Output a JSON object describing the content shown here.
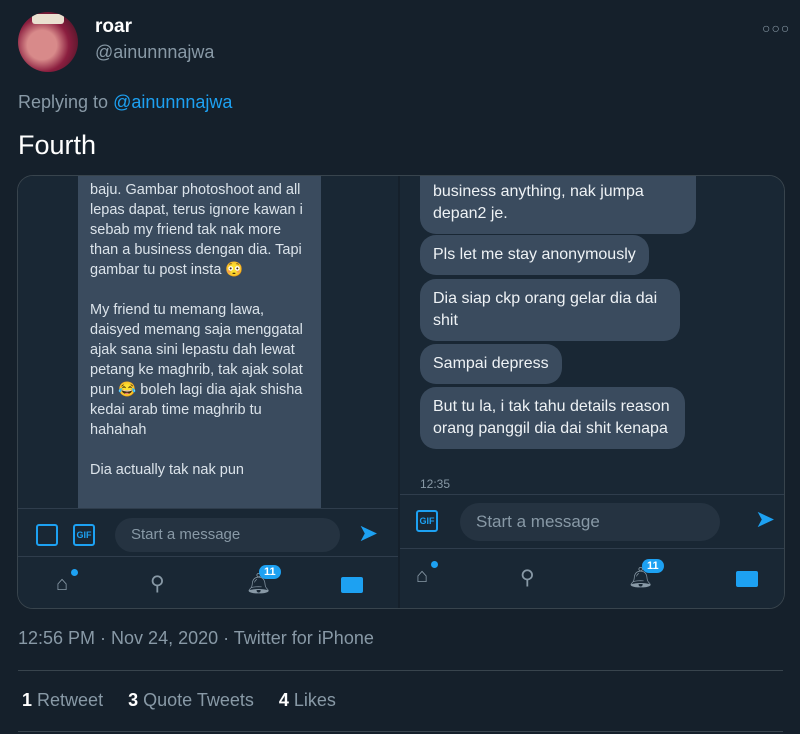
{
  "tweet": {
    "display_name": "roar",
    "handle": "@ainunnnajwa",
    "more_icon": "more-dots-icon",
    "replying_prefix": "Replying to",
    "replying_mention": "@ainunnnajwa",
    "text": "Fourth"
  },
  "media": {
    "left": {
      "paragraph1": "baju. Gambar photoshoot and all lepas dapat, terus ignore kawan i sebab my friend tak nak more than a business dengan dia. Tapi gambar tu post insta 😳",
      "paragraph2": "My friend tu memang lawa, daisyed memang saja menggatal ajak sana sini lepastu dah lewat petang ke maghrib, tak ajak solat pun 😂 boleh lagi dia ajak shisha kedai arab time maghrib tu hahahah",
      "paragraph3": "Dia actually tak nak pun",
      "composer_placeholder": "Start a message",
      "gif_label": "GIF",
      "notif_count": "11"
    },
    "right": {
      "messages": [
        "business anything, nak jumpa depan2 je.",
        "Pls let me stay anonymously",
        "Dia siap ckp orang gelar dia dai shit",
        "Sampai depress",
        "But tu la, i tak tahu details reason orang panggil dia dai shit kenapa"
      ],
      "time": "12:35",
      "composer_placeholder": "Start a message",
      "gif_label": "GIF",
      "notif_count": "11"
    }
  },
  "meta": {
    "timestamp": "12:56 PM · Nov 24, 2020 · Twitter for iPhone"
  },
  "stats": {
    "retweets_count": "1",
    "retweets_label": "Retweet",
    "quotes_count": "3",
    "quotes_label": "Quote Tweets",
    "likes_count": "4",
    "likes_label": "Likes"
  },
  "colors": {
    "background": "#15202b",
    "accent": "#1da1f2",
    "secondary_text": "#8899a6",
    "bubble": "#3a4b5e"
  }
}
